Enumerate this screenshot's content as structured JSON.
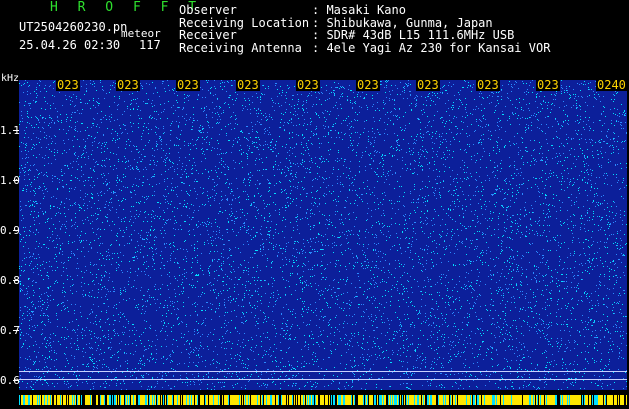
{
  "header": {
    "app_title": "H R O F F T",
    "filename": "UT2504260230.pn",
    "tag": "meteor",
    "date_time": "25.04.26 02:30",
    "count": "117"
  },
  "info": [
    {
      "key": "Observer",
      "value": ": Masaki Kano"
    },
    {
      "key": "Receiving Location",
      "value": ": Shibukawa, Gunma, Japan"
    },
    {
      "key": "Receiver",
      "value": ": SDR# 43dB L15 111.6MHz USB"
    },
    {
      "key": "Receiving Antenna",
      "value": ": 4ele Yagi Az 230 for Kansai VOR"
    }
  ],
  "axis": {
    "unit": "kHz",
    "y_labels": [
      "1.1",
      "1.0",
      "0.9",
      "0.8",
      "0.7",
      "0.6"
    ],
    "time_labels": [
      "023",
      "023",
      "023",
      "023",
      "023",
      "023",
      "023",
      "023",
      "023",
      "0240"
    ]
  },
  "colors": {
    "background": "#0c1f9a",
    "noise_light": "#00e0ff",
    "noise_mid": "#2a8aff",
    "time_label": "#ffd400",
    "bottom_band": "#ffe800"
  }
}
